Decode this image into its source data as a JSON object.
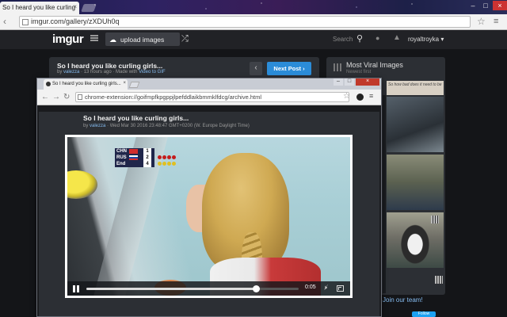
{
  "back_browser": {
    "tab_title": "So I heard you like curling",
    "tab_close": "×",
    "window_controls": {
      "minimize": "–",
      "maximize": "□",
      "close": "×"
    },
    "nav": {
      "back": "‹",
      "forward": "›",
      "reload": "↻"
    },
    "url": "imgur.com/gallery/zXDUh0q",
    "star": "☆",
    "menu": "≡"
  },
  "imgur": {
    "logo": "imgur",
    "upload_label": "upload images",
    "upload_icon": "cloud-upload-icon",
    "random_icon": "⤮",
    "search_label": "Search",
    "search_icon": "⚲",
    "chat_icon": "●",
    "notif_icon": "▲",
    "username": "royaltroyka ▾",
    "post": {
      "title": "So I heard you like curling girls...",
      "meta_by": "by",
      "meta_user": "valezza",
      "meta_rest": "· 13 hours ago · Made with",
      "meta_link": "Video to GIF",
      "prev": "‹",
      "next": "Next Post ›"
    },
    "viral": {
      "title": "Most Viral Images",
      "subtitle": "Newest first",
      "thumb_1_text": "So how bad does it need to be"
    },
    "join_team": "Join our team!",
    "follow": "Follow"
  },
  "popup": {
    "tab_title": "So I heard you like curling girls...",
    "tab_close": "×",
    "window_controls": {
      "minimize": "–",
      "maximize": "□",
      "close": "×"
    },
    "nav": {
      "back": "←",
      "forward": "→",
      "reload": "↻"
    },
    "url": "chrome-extension://goifmpfkpgppjlpefddlaikbmmklfdcg/archive.html",
    "star": "☆",
    "menu": "≡",
    "archive": {
      "title": "So I heard you like curling girls...",
      "meta_by": "by",
      "meta_user": "valezza",
      "meta_rest": "· Wed Mar 30 2016 23:48:47 GMT+0200 (W. Europe Daylight Time)"
    },
    "video": {
      "scorebug": [
        {
          "team": "CHN",
          "score": "1"
        },
        {
          "team": "RUS",
          "score": "2"
        },
        {
          "team": "End",
          "score": "4"
        }
      ],
      "time": "0:05",
      "progress_percent": 80,
      "mute_icon": "🔇"
    }
  },
  "colors": {
    "imgur_bg": "#141518",
    "panel": "#2c2f34",
    "next_button": "#2b8cd8",
    "link": "#85bbef"
  }
}
